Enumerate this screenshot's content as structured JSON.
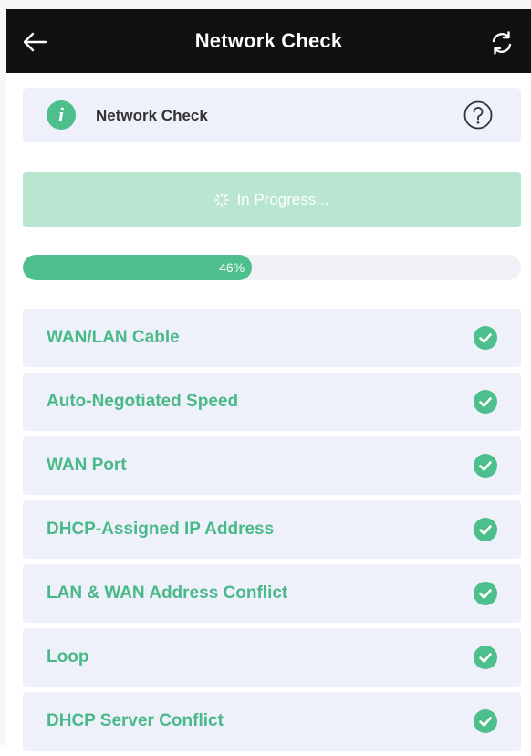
{
  "header": {
    "title": "Network Check",
    "back_icon": "arrow-left-icon",
    "refresh_icon": "refresh-icon"
  },
  "info": {
    "title": "Network Check",
    "info_icon": "info-icon",
    "info_glyph": "i",
    "help_icon": "help-icon"
  },
  "status": {
    "label": "In Progress...",
    "spinner_icon": "spinner-icon"
  },
  "progress": {
    "percent": 46,
    "label": "46%"
  },
  "checks": [
    {
      "label": "WAN/LAN Cable",
      "status": "passed"
    },
    {
      "label": "Auto-Negotiated Speed",
      "status": "passed"
    },
    {
      "label": "WAN Port",
      "status": "passed"
    },
    {
      "label": "DHCP-Assigned IP Address",
      "status": "passed"
    },
    {
      "label": "LAN & WAN Address Conflict",
      "status": "passed"
    },
    {
      "label": "Loop",
      "status": "passed"
    },
    {
      "label": "DHCP Server Conflict",
      "status": "passed"
    }
  ],
  "colors": {
    "accent": "#4cbf8d",
    "accent_light": "#b9e6d1",
    "card_bg": "#eef1fa",
    "header_bg": "#0f1113"
  }
}
